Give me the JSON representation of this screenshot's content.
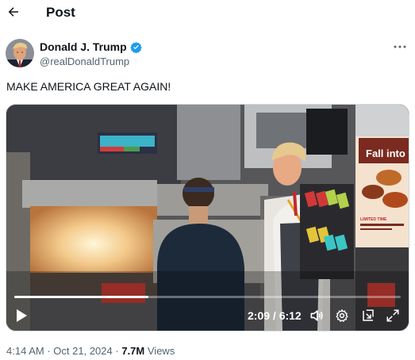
{
  "header": {
    "title": "Post"
  },
  "author": {
    "name": "Donald J. Trump",
    "handle": "@realDonaldTrump"
  },
  "tweet": {
    "text": "MAKE AMERICA GREAT AGAIN!"
  },
  "video": {
    "time": "2:09 / 6:12",
    "progress": 0.347,
    "sign_text": "Fall into fla",
    "sign_small": "LIMITED TIME"
  },
  "meta": {
    "time": "4:14 AM",
    "date": "Oct 21, 2024",
    "sep1": "·",
    "sep2": "·",
    "views": "7.7M",
    "views_label": "Views"
  },
  "colors": {
    "verified": "#1d9bf0",
    "secondary": "#536471",
    "text": "#0f1419"
  }
}
